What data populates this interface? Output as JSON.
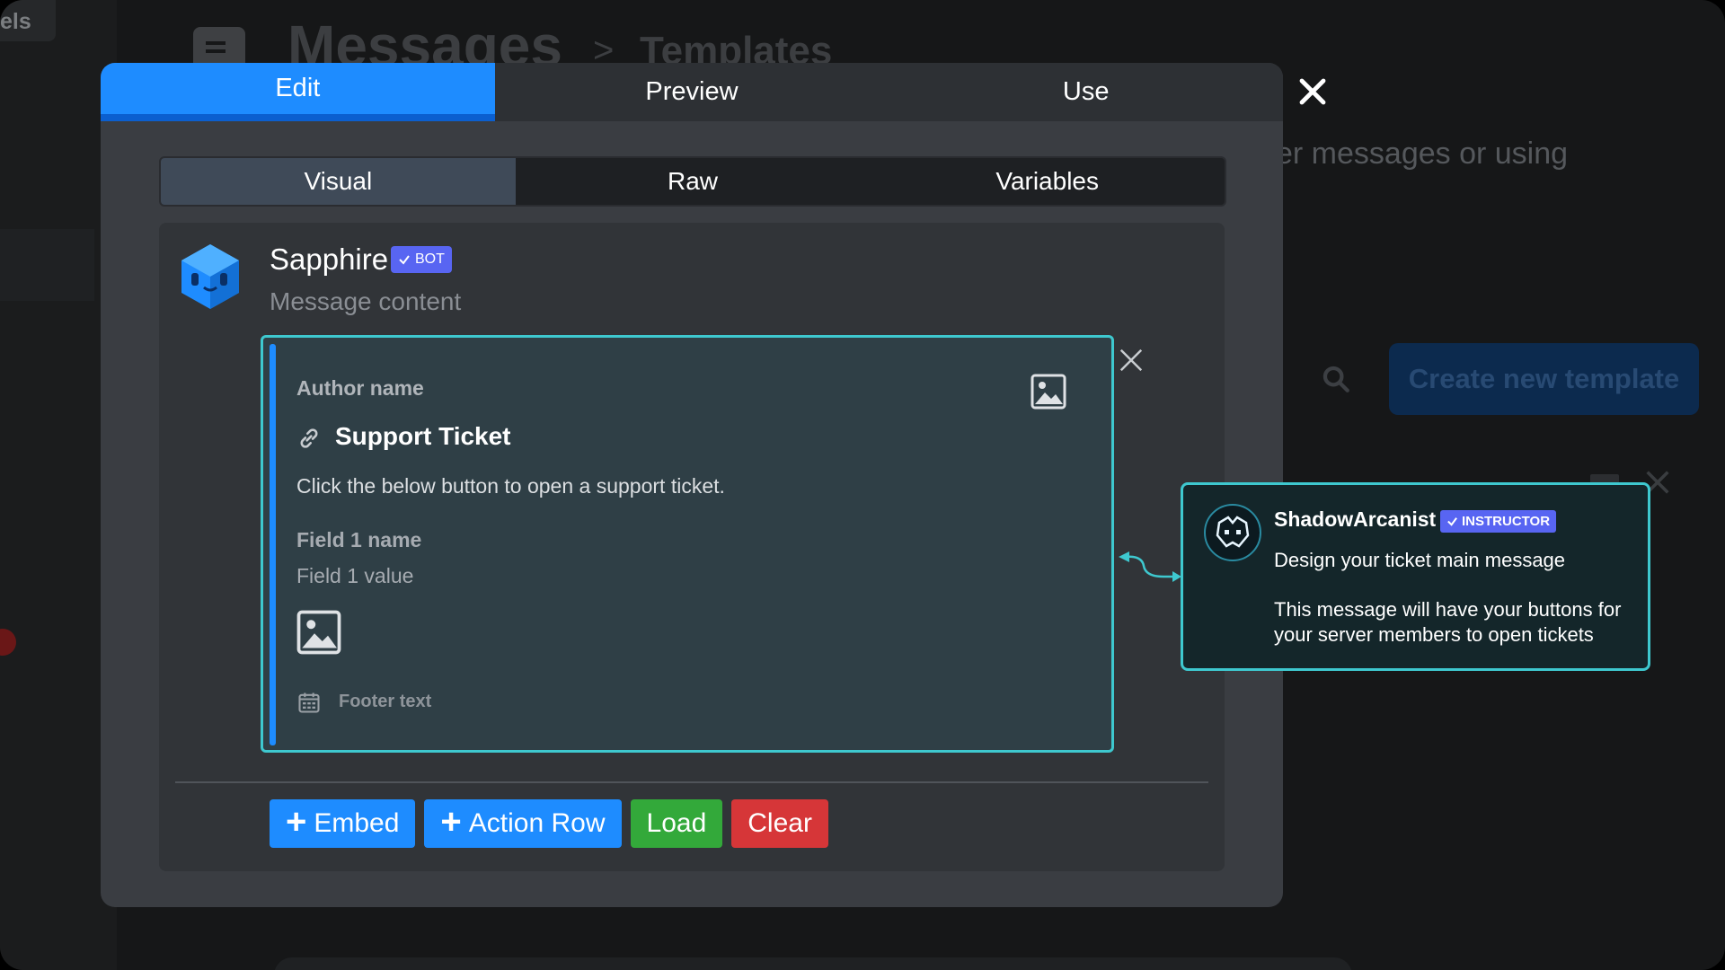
{
  "background": {
    "left_chip": "els",
    "title": "Messages",
    "breadcrumb_sep": ">",
    "breadcrumb": "Templates",
    "description": "er messages or using",
    "create_button": "Create new template"
  },
  "modal": {
    "tabs": [
      {
        "label": "Edit",
        "active": true
      },
      {
        "label": "Preview",
        "active": false
      },
      {
        "label": "Use",
        "active": false
      }
    ],
    "subtabs": [
      {
        "label": "Visual",
        "active": true
      },
      {
        "label": "Raw",
        "active": false
      },
      {
        "label": "Variables",
        "active": false
      }
    ]
  },
  "message": {
    "bot_name": "Sapphire",
    "bot_badge": "BOT",
    "content_placeholder": "Message content"
  },
  "embed": {
    "author": "Author name",
    "title": "Support Ticket",
    "description": "Click the below button to open a support ticket.",
    "field_name": "Field 1 name",
    "field_value": "Field 1 value",
    "footer": "Footer text",
    "accent_color": "#1e8cff"
  },
  "actions": {
    "embed": "Embed",
    "action_row": "Action Row",
    "load": "Load",
    "clear": "Clear"
  },
  "tooltip": {
    "user": "ShadowArcanist",
    "badge": "INSTRUCTOR",
    "line1": "Design your ticket main message",
    "line2": "This message will have your buttons for your server members to open tickets"
  },
  "colors": {
    "primary": "#1e8cff",
    "success": "#33a93a",
    "danger": "#d63638",
    "teal": "#3ec8cf",
    "badge": "#5865f2"
  }
}
